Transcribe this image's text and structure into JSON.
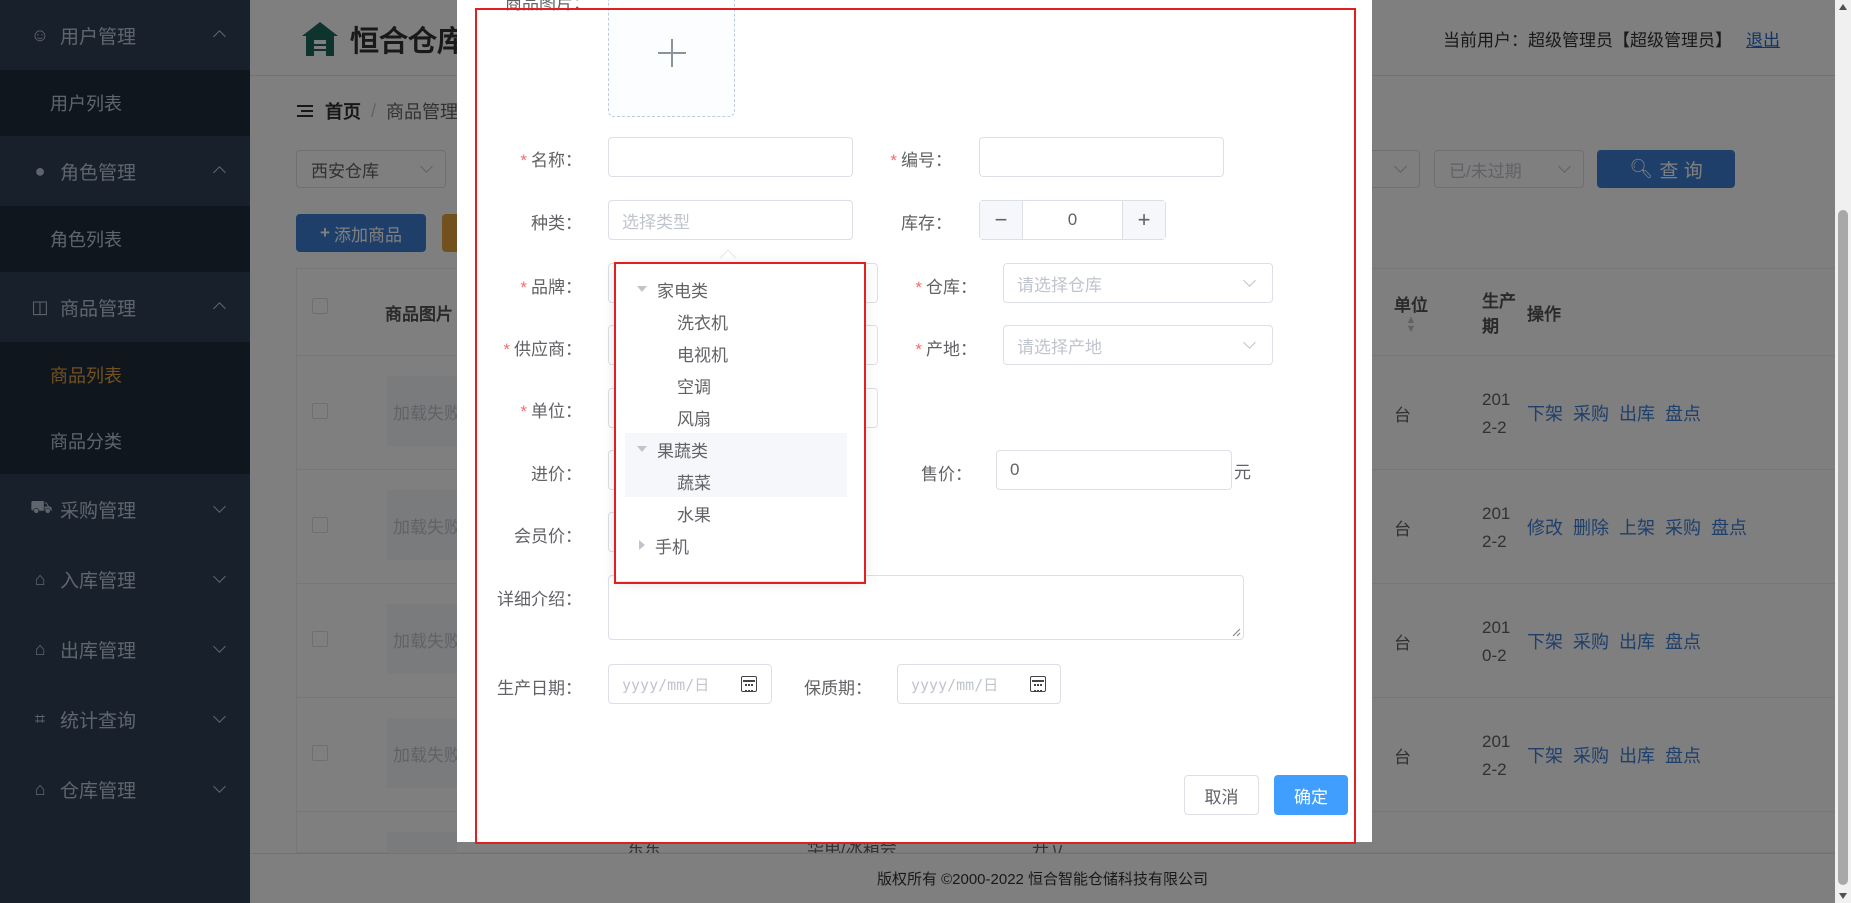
{
  "sidebar": {
    "groups": [
      {
        "label": "用户管理",
        "icon": "user-icon",
        "expanded": true,
        "items": [
          "用户列表"
        ]
      },
      {
        "label": "角色管理",
        "icon": "role-icon",
        "expanded": true,
        "items": [
          "角色列表"
        ]
      },
      {
        "label": "商品管理",
        "icon": "bag-icon",
        "expanded": true,
        "items": [
          "商品列表",
          "商品分类"
        ]
      },
      {
        "label": "采购管理",
        "icon": "cart-icon",
        "expanded": false,
        "items": []
      },
      {
        "label": "入库管理",
        "icon": "inbound-icon",
        "expanded": false,
        "items": []
      },
      {
        "label": "出库管理",
        "icon": "outbound-icon",
        "expanded": false,
        "items": []
      },
      {
        "label": "统计查询",
        "icon": "chart-icon",
        "expanded": false,
        "items": []
      },
      {
        "label": "仓库管理",
        "icon": "warehouse-icon",
        "expanded": false,
        "items": []
      }
    ],
    "active_item": "商品列表"
  },
  "header": {
    "logo_text": "恒合仓库",
    "user_label": "当前用户：超级管理员【超级管理员】",
    "logout": "退出"
  },
  "breadcrumb": {
    "home": "首页",
    "current": "商品管理"
  },
  "filters": {
    "warehouse": "西安仓库",
    "expiry_placeholder": "已/未过期",
    "query": "查 询"
  },
  "toolbar": {
    "add": "添加商品"
  },
  "table": {
    "headers": {
      "image": "商品图片",
      "unit": "单位",
      "date_a": "生产",
      "date_b": "期",
      "ops": "操作"
    },
    "rows": [
      {
        "img": "加载失败",
        "unit": "台",
        "date1": "201",
        "date2": "2-2",
        "ops": [
          "下架",
          "采购",
          "出库",
          "盘点"
        ]
      },
      {
        "img": "加载失败",
        "unit": "台",
        "date1": "201",
        "date2": "2-2",
        "ops": [
          "修改",
          "删除",
          "上架",
          "采购",
          "盘点"
        ]
      },
      {
        "img": "加载失败",
        "unit": "台",
        "date1": "201",
        "date2": "0-2",
        "ops": [
          "下架",
          "采购",
          "出库",
          "盘点"
        ]
      },
      {
        "img": "加载失败",
        "unit": "台",
        "date1": "201",
        "date2": "2-2",
        "ops": [
          "下架",
          "采购",
          "出库",
          "盘点"
        ]
      }
    ],
    "partial_row": {
      "c1": "东东",
      "c2": "华电/冰箱会",
      "c3": "开立"
    }
  },
  "footer": "版权所有 ©2000-2022  恒合智能仓储科技有限公司",
  "dialog": {
    "image_label": "商品图片：",
    "name_label": "名称：",
    "code_label": "编号：",
    "type_label": "种类：",
    "type_placeholder": "选择类型",
    "stock_label": "库存：",
    "stock_value": "0",
    "brand_label": "品牌：",
    "warehouse_label": "仓库：",
    "warehouse_placeholder": "请选择仓库",
    "supplier_label": "供应商：",
    "origin_label": "产地：",
    "origin_placeholder": "请选择产地",
    "unit_label": "单位：",
    "in_price_label": "进价：",
    "sale_price_label": "售价：",
    "sale_price_value": "0",
    "yuan": "元",
    "member_price_label": "会员价：",
    "detail_label": "详细介绍：",
    "prod_date_label": "生产日期：",
    "date_placeholder": "yyyy/mm/日",
    "shelf_life_label": "保质期：",
    "cancel": "取消",
    "ok": "确定"
  },
  "tree": [
    {
      "label": "家电类",
      "level": 0,
      "state": "open"
    },
    {
      "label": "洗衣机",
      "level": 1
    },
    {
      "label": "电视机",
      "level": 1
    },
    {
      "label": "空调",
      "level": 1
    },
    {
      "label": "风扇",
      "level": 1
    },
    {
      "label": "果蔬类",
      "level": 0,
      "state": "open",
      "highlight": true
    },
    {
      "label": "蔬菜",
      "level": 1,
      "highlight": true
    },
    {
      "label": "水果",
      "level": 1
    },
    {
      "label": "手机",
      "level": 0,
      "state": "closed"
    }
  ],
  "colors": {
    "sidebar_bg": "#304156",
    "active": "#e6a23c",
    "primary": "#409eff",
    "required": "#f56c6c",
    "annotation": "#e02020"
  }
}
